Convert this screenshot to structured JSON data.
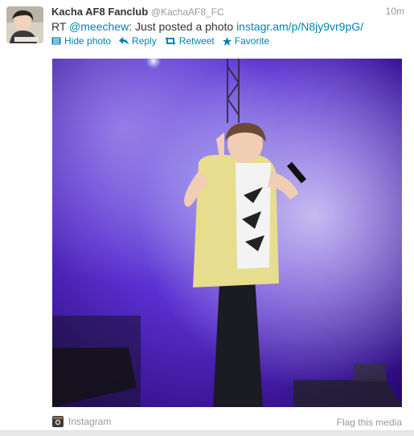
{
  "tweet": {
    "fullname": "Kacha AF8 Fanclub",
    "username": "@KachaAF8_FC",
    "time": "10m",
    "text_prefix": "RT",
    "mention": "@meechew",
    "text_middle": ": Just posted a photo",
    "link": "instagr.am/p/N8jy9vr9pG/"
  },
  "actions": {
    "hide_photo": "Hide photo",
    "reply": "Reply",
    "retweet": "Retweet",
    "favorite": "Favorite"
  },
  "media": {
    "source": "Instagram",
    "flag": "Flag this media"
  },
  "colors": {
    "link": "#0084b4",
    "meta": "#999999",
    "stage_purple": "#5a2fd0"
  }
}
